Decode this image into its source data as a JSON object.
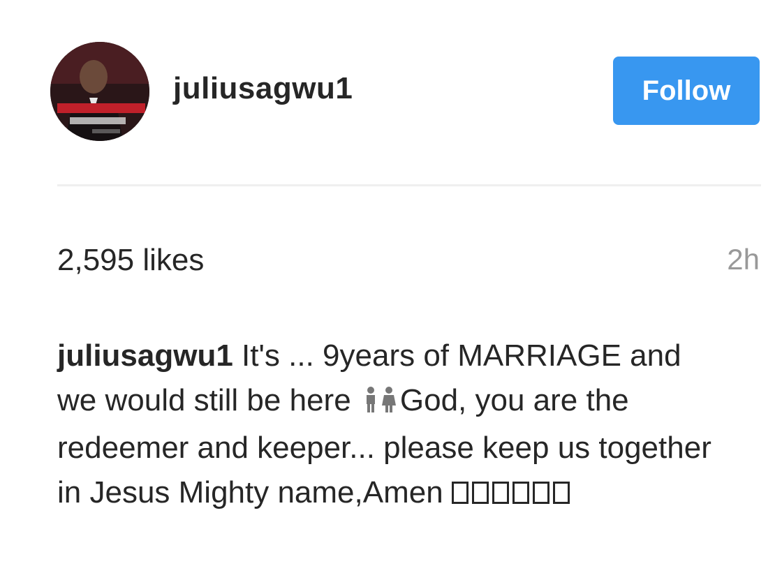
{
  "post": {
    "username": "juliusagwu1",
    "follow_label": "Follow",
    "likes": "2,595 likes",
    "time": "2h",
    "caption": {
      "username": "juliusagwu1",
      "text_before_icon": " It's ... 9years of MARRIAGE and we would still be here ",
      "inline_icon": "couple-icon",
      "text_after_icon": "God, you are the redeemer and keeper... please keep us together in Jesus Mighty name,Amen ",
      "missing_glyph_count": 6
    }
  },
  "colors": {
    "follow_button": "#3897f0",
    "text": "#262626",
    "muted": "#999999",
    "divider": "#efefef"
  }
}
